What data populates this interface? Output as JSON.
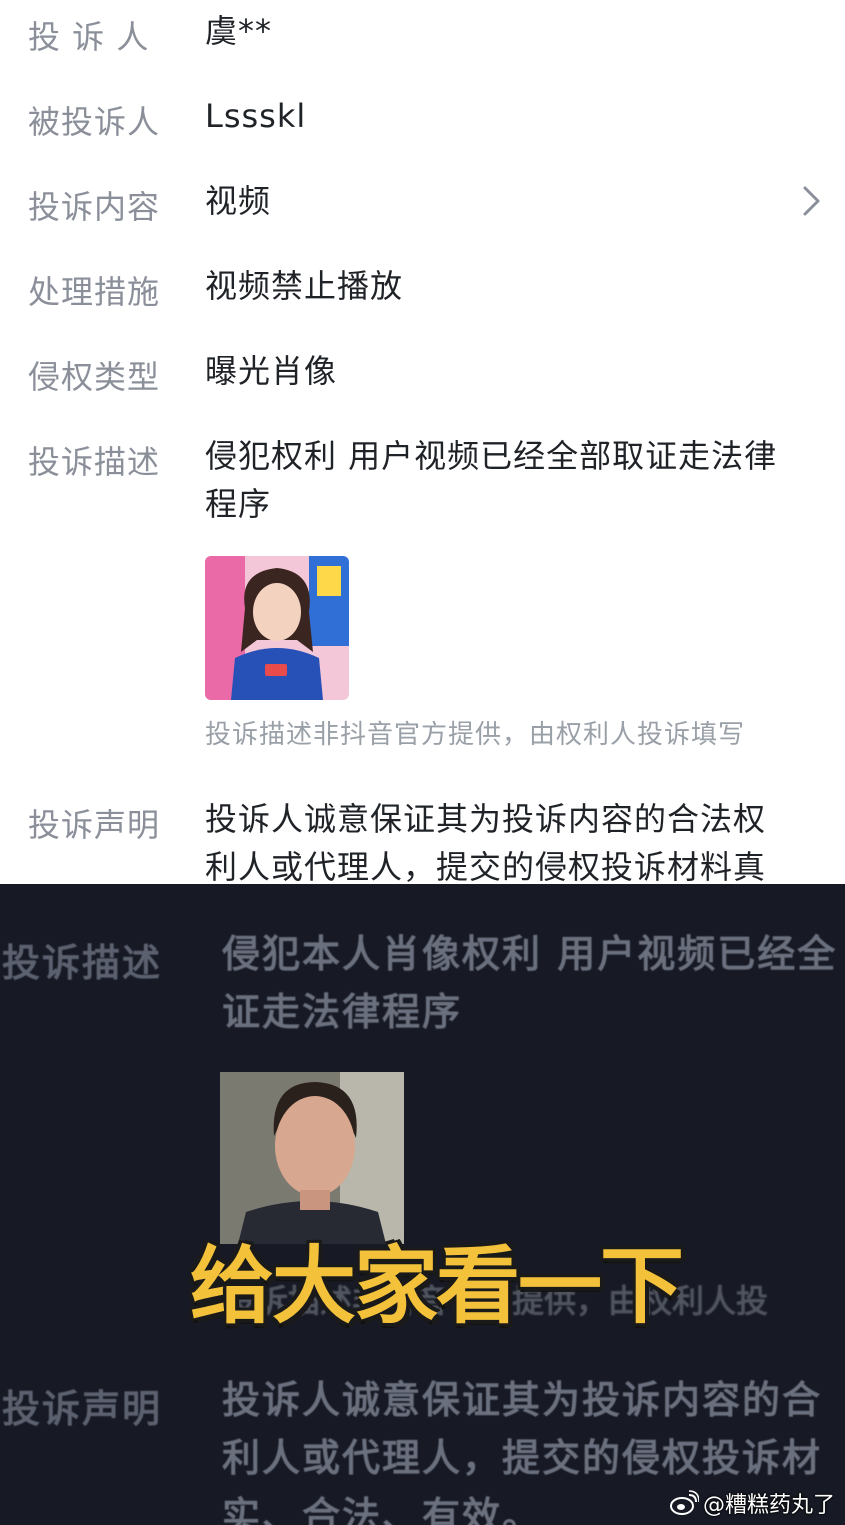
{
  "top": {
    "rows": [
      {
        "label": "投 诉 人",
        "value": "虞**"
      },
      {
        "label": "被投诉人",
        "value": "Lssskl"
      },
      {
        "label": "投诉内容",
        "value": "视频"
      },
      {
        "label": "处理措施",
        "value": "视频禁止播放"
      },
      {
        "label": "侵权类型",
        "value": "曝光肖像"
      },
      {
        "label": "投诉描述",
        "value_line1": "侵犯权利 用户视频已经全部取证走法律",
        "value_line2": "程序"
      },
      {
        "label": "投诉声明",
        "value_line1": "投诉人诚意保证其为投诉内容的合法权",
        "value_line2": "利人或代理人，提交的侵权投诉材料真"
      }
    ],
    "note": "投诉描述非抖音官方提供，由权利人投诉填写",
    "chevron_icon": "chevron-right-icon"
  },
  "bottom": {
    "desc_label": "投诉描述",
    "desc_line1": "侵犯本人肖像权利 用户视频已经全",
    "desc_line2": "证走法律程序",
    "note": "投诉描述非抖音官方提供，由权利人投",
    "caption": "给大家看一下",
    "stmt_label": "投诉声明",
    "stmt_line1": "投诉人诚意保证其为投诉内容的合",
    "stmt_line2": "利人或代理人，提交的侵权投诉材",
    "stmt_line3": "实、合法、有效。"
  },
  "watermark": {
    "text": "@糟糕药丸了",
    "icon": "weibo-icon"
  },
  "colors": {
    "caption": "#f3c23a",
    "dark_bg": "#171a24",
    "label_gray": "#8a8f99"
  }
}
